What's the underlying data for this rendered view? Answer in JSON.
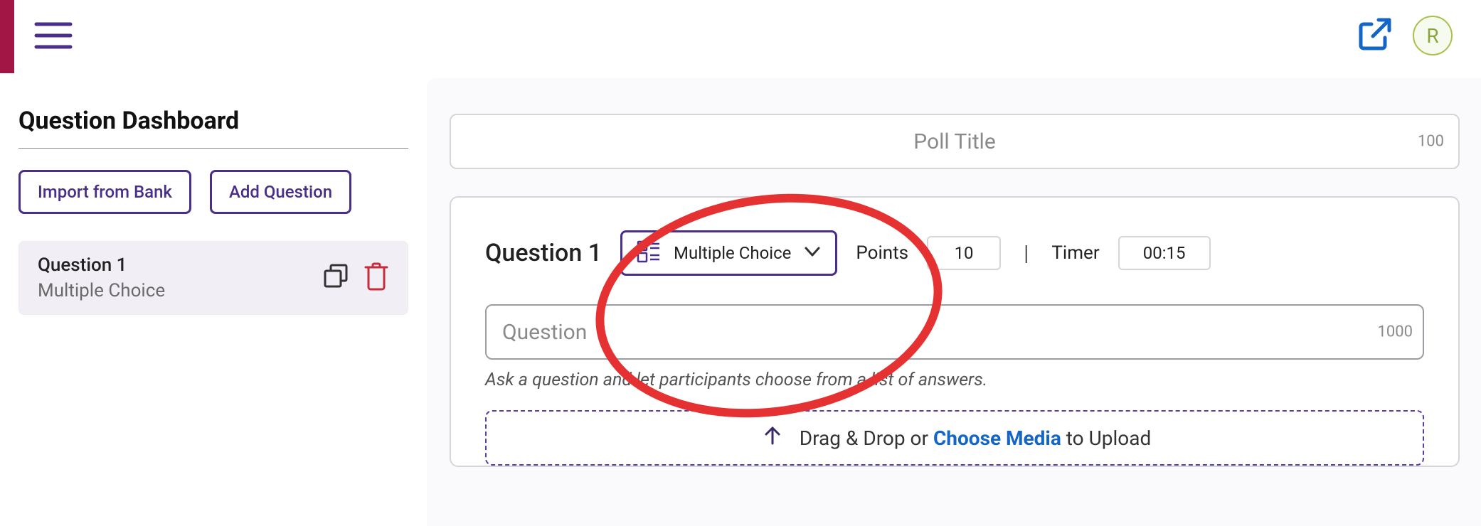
{
  "colors": {
    "brand_purple": "#4a2f8a",
    "brand_maroon": "#a21646",
    "danger_red": "#c62d3b",
    "link_blue": "#1466c6"
  },
  "topbar": {
    "avatar_initial": "R"
  },
  "sidebar": {
    "title": "Question Dashboard",
    "import_btn": "Import from Bank",
    "add_btn": "Add Question",
    "card": {
      "title": "Question 1",
      "type": "Multiple Choice"
    }
  },
  "main": {
    "title_placeholder": "Poll Title",
    "title_char_remaining": "100",
    "question": {
      "number": "Question 1",
      "type_label": "Multiple Choice",
      "points_label": "Points",
      "points_value": "10",
      "timer_label": "Timer",
      "timer_value": "00:15",
      "input_placeholder": "Question",
      "input_char_remaining": "1000",
      "hint": "Ask a question and let participants choose from a list of answers.",
      "media_pre": "Drag & Drop or ",
      "media_choose": "Choose Media",
      "media_post": " to Upload"
    }
  }
}
